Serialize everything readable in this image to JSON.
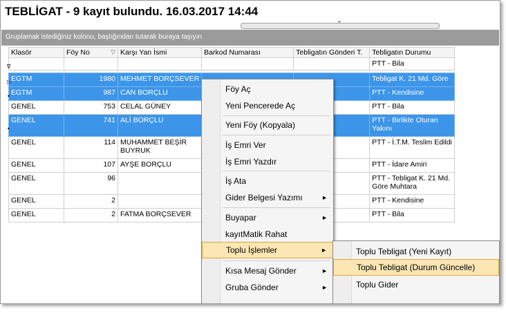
{
  "title": "TEBLİGAT - 9 kayıt bulundu.  16.03.2017 14:44",
  "splitter_glyph": "⌃",
  "group_hint": "Gruplamak istediğiniz kolonu, başlığından tutarak buraya taşıyın",
  "columns": [
    "Klasör",
    "Föy No",
    "Karşı Yan İsmi",
    "Barkod Numarası",
    "Tebligatın Gönderi T.",
    "Tebligatın Durumu"
  ],
  "filter_row": {
    "klasor": "",
    "foy": "",
    "karsi": "",
    "barkod": "",
    "gonderi": "",
    "durum": "PTT - Bila"
  },
  "rows": [
    {
      "klasor": "EGTM",
      "foy": "1980",
      "karsi": "MEHMET BORÇSEVER",
      "durum": "Tebligat K. 21 Md. Göre",
      "selected": true
    },
    {
      "klasor": "EGTM",
      "foy": "987",
      "karsi": "CAN BORÇLU",
      "durum": "PTT - Kendisine",
      "selected": true
    },
    {
      "klasor": "GENEL",
      "foy": "753",
      "karsi": "CELAL GÜNEY",
      "durum": "PTT - Bila",
      "selected": false
    },
    {
      "klasor": "GENEL",
      "foy": "741",
      "karsi": "ALİ BORÇLU",
      "durum": "PTT - Birlikte Oturan Yakını",
      "selected": true
    },
    {
      "klasor": "GENEL",
      "foy": "114",
      "karsi": "MUHAMMET BEŞİR BUYRUK",
      "durum": "PTT - İ.T.M. Teslim Edildi",
      "selected": false
    },
    {
      "klasor": "GENEL",
      "foy": "107",
      "karsi": "AYŞE BORÇLU",
      "durum": "PTT - İdare Amiri",
      "selected": false
    },
    {
      "klasor": "GENEL",
      "foy": "96",
      "karsi": "",
      "durum": "PTT - Tebligat K. 21 Md. Göre Muhtara",
      "selected": false
    },
    {
      "klasor": "GENEL",
      "foy": "2",
      "karsi": "",
      "durum": "PTT - Kendisine",
      "selected": false
    },
    {
      "klasor": "GENEL",
      "foy": "2",
      "karsi": "FATMA BORÇSEVER",
      "durum": "PTT - Bila",
      "selected": false
    }
  ],
  "indicators": {
    "filter": "∇",
    "current": "▷",
    "marked": "•"
  },
  "context_menu": {
    "items": [
      "Föy Aç",
      "Yeni Pencerede Aç",
      "Yeni Föy (Kopyala)",
      "İş Emri Ver",
      "İş Emri Yazdır",
      "İş Ata",
      "Gider Belgesi Yazımı",
      "Buyapar",
      "kayıtMatik Rahat",
      "Toplu İşlemler",
      "Kısa Mesaj Gönder",
      "Gruba Gönder"
    ],
    "arrow": "►"
  },
  "submenu": {
    "items": [
      "Toplu Tebligat (Yeni Kayıt)",
      "Toplu Tebligat (Durum Güncelle)",
      "Toplu Gider"
    ]
  },
  "colors": {
    "selection": "#3c95e8",
    "highlight": "#fce6b4",
    "group_bar": "#9b9b9b"
  }
}
